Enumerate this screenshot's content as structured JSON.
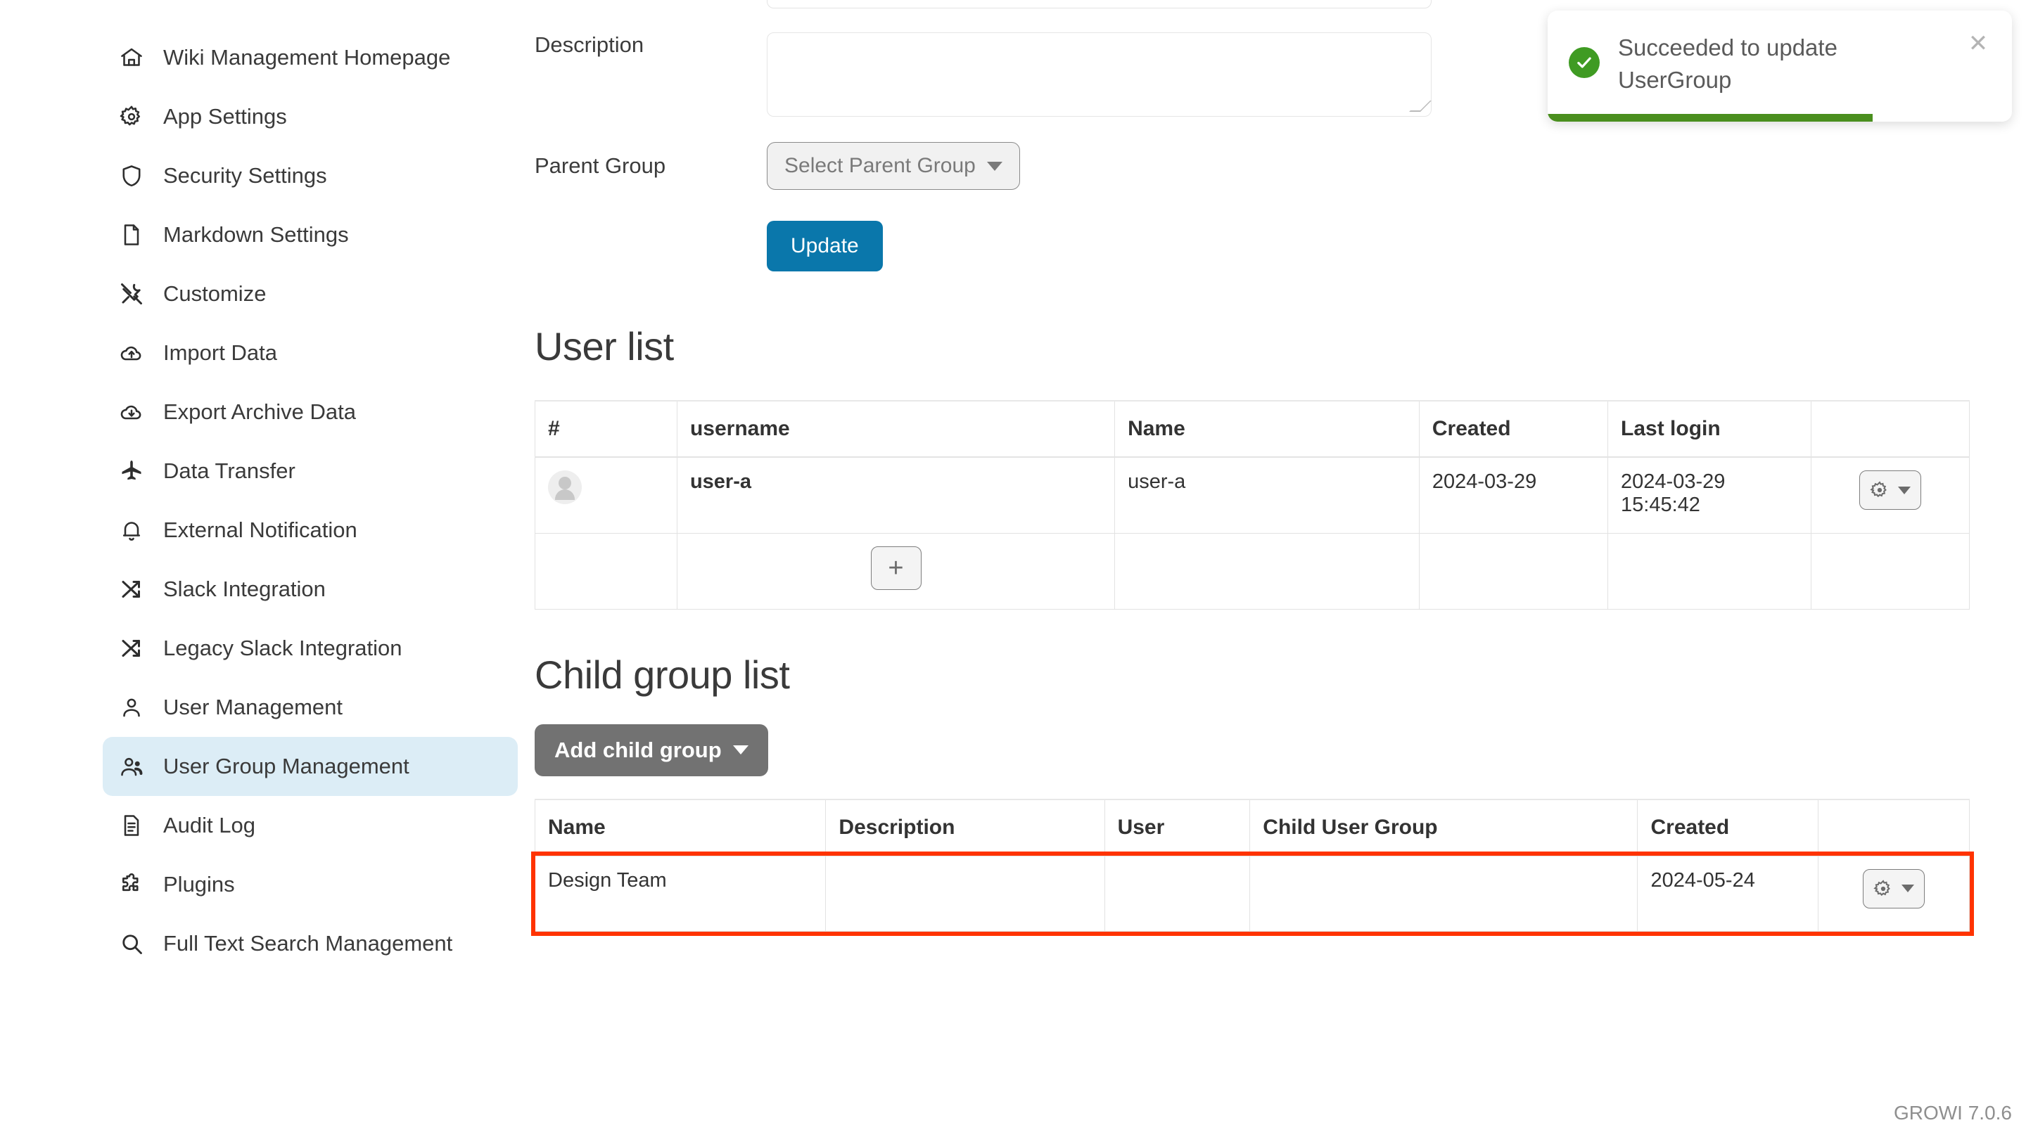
{
  "sidebar": {
    "items": [
      {
        "label": "Wiki Management Homepage",
        "icon": "home-icon",
        "active": false
      },
      {
        "label": "App Settings",
        "icon": "gear-icon",
        "active": false
      },
      {
        "label": "Security Settings",
        "icon": "shield-icon",
        "active": false
      },
      {
        "label": "Markdown Settings",
        "icon": "document-icon",
        "active": false
      },
      {
        "label": "Customize",
        "icon": "tools-icon",
        "active": false
      },
      {
        "label": "Import Data",
        "icon": "cloud-upload-icon",
        "active": false
      },
      {
        "label": "Export Archive Data",
        "icon": "cloud-download-icon",
        "active": false
      },
      {
        "label": "Data Transfer",
        "icon": "airplane-icon",
        "active": false
      },
      {
        "label": "External Notification",
        "icon": "bell-icon",
        "active": false
      },
      {
        "label": "Slack Integration",
        "icon": "shuffle-icon",
        "active": false
      },
      {
        "label": "Legacy Slack Integration",
        "icon": "shuffle-icon",
        "active": false
      },
      {
        "label": "User Management",
        "icon": "person-icon",
        "active": false
      },
      {
        "label": "User Group Management",
        "icon": "people-icon",
        "active": true
      },
      {
        "label": "Audit Log",
        "icon": "list-document-icon",
        "active": false
      },
      {
        "label": "Plugins",
        "icon": "puzzle-icon",
        "active": false
      },
      {
        "label": "Full Text Search Management",
        "icon": "search-icon",
        "active": false
      }
    ]
  },
  "toast": {
    "message": "Succeeded to update UserGroup",
    "icon": "check-circle-icon",
    "close_icon": "close-icon",
    "progress_percent": 70,
    "accent_color": "#4a8f1e"
  },
  "form": {
    "description_label": "Description",
    "description_value": "",
    "parent_group_label": "Parent Group",
    "parent_group_selected": "Select Parent Group",
    "update_label": "Update",
    "update_color": "#0a77ab"
  },
  "user_list": {
    "title": "User list",
    "columns": [
      "#",
      "username",
      "Name",
      "Created",
      "Last login",
      ""
    ],
    "rows": [
      {
        "avatar": "avatar",
        "username": "user-a",
        "name": "user-a",
        "created": "2024-03-29",
        "last_login": "2024-03-29 15:45:42",
        "action_icon": "gear-icon"
      }
    ],
    "add_user_label": "+"
  },
  "child_group_list": {
    "title": "Child group list",
    "add_child_group_label": "Add child group",
    "columns": [
      "Name",
      "Description",
      "User",
      "Child User Group",
      "Created",
      ""
    ],
    "rows": [
      {
        "name": "Design Team",
        "description": "",
        "user": "",
        "child_user_group": "",
        "created": "2024-05-24",
        "action_icon": "gear-icon",
        "highlighted": true
      }
    ],
    "highlight_color": "#ff3300"
  },
  "footer": {
    "version": "GROWI 7.0.6"
  }
}
